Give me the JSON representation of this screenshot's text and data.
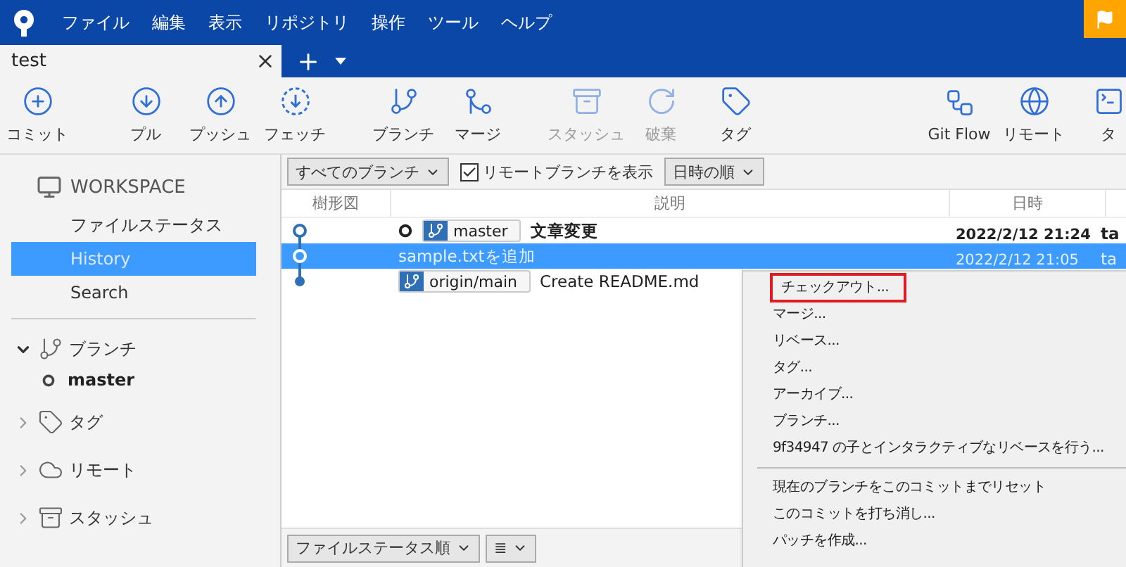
{
  "menu_bar": [
    "ファイル",
    "編集",
    "表示",
    "リポジトリ",
    "操作",
    "ツール",
    "ヘルプ"
  ],
  "tabs": [
    {
      "label": "test",
      "selected": true
    }
  ],
  "toolbar": {
    "groups": [
      [
        {
          "label": "コミット",
          "disabled": false
        }
      ],
      [
        {
          "label": "プル",
          "disabled": false
        },
        {
          "label": "プッシュ",
          "disabled": false
        },
        {
          "label": "フェッチ",
          "disabled": false
        }
      ],
      [
        {
          "label": "ブランチ",
          "disabled": false
        },
        {
          "label": "マージ",
          "disabled": false
        }
      ],
      [
        {
          "label": "スタッシュ",
          "disabled": true
        },
        {
          "label": "破棄",
          "disabled": true
        },
        {
          "label": "タグ",
          "disabled": false
        }
      ],
      [
        {
          "label": "Git Flow",
          "disabled": false
        },
        {
          "label": "リモート",
          "disabled": false
        },
        {
          "label": "タ",
          "disabled": false
        }
      ]
    ]
  },
  "sidebar": {
    "workspace": {
      "title": "WORKSPACE",
      "items": [
        {
          "label": "ファイルステータス",
          "selected": false
        },
        {
          "label": "History",
          "selected": true
        },
        {
          "label": "Search",
          "selected": false
        }
      ]
    },
    "sections": [
      {
        "label": "ブランチ",
        "expanded": true,
        "children": [
          {
            "label": "master"
          }
        ]
      },
      {
        "label": "タグ",
        "expanded": false
      },
      {
        "label": "リモート",
        "expanded": false
      },
      {
        "label": "スタッシュ",
        "expanded": false
      }
    ]
  },
  "filters": {
    "branches": "すべてのブランチ",
    "show_remote": {
      "label": "リモートブランチを表示",
      "checked": true
    },
    "order": "日時の順"
  },
  "table": {
    "columns": [
      "樹形図",
      "説明",
      "日時"
    ],
    "rows": [
      {
        "head": true,
        "refs": [
          "master"
        ],
        "description": "文章変更",
        "date": "2022/2/12  21:24",
        "author": "ta",
        "selected": false,
        "node_filled": false
      },
      {
        "head": false,
        "refs": [],
        "description": "sample.txtを追加",
        "date": "2022/2/12  21:05",
        "author": "ta",
        "selected": true,
        "node_filled": false
      },
      {
        "head": false,
        "refs": [
          "origin/main"
        ],
        "description": "Create README.md",
        "selected": false,
        "node_filled": true
      }
    ]
  },
  "context_menu": {
    "groups": [
      [
        {
          "label": "チェックアウト...",
          "highlighted": true
        },
        {
          "label": "マージ...",
          "highlighted": false
        },
        {
          "label": "リベース...",
          "highlighted": false
        },
        {
          "label": "タグ...",
          "highlighted": false
        },
        {
          "label": "アーカイブ...",
          "highlighted": false
        },
        {
          "label": "ブランチ...",
          "highlighted": false
        },
        {
          "label": "9f34947 の子とインタラクティブなリベースを行う...",
          "highlighted": false
        }
      ],
      [
        {
          "label": "現在のブランチをこのコミットまでリセット",
          "highlighted": false
        },
        {
          "label": "このコミットを打ち消し...",
          "highlighted": false
        },
        {
          "label": "パッチを作成...",
          "highlighted": false
        }
      ]
    ]
  },
  "bottom_bar": {
    "sort": "ファイルステータス順",
    "view": "≣"
  }
}
